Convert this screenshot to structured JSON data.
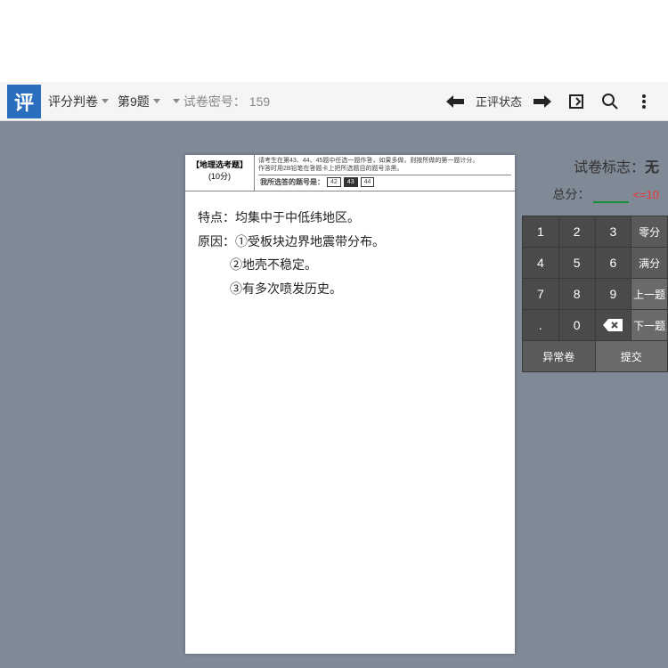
{
  "topbar": {
    "logo_text": "评",
    "grading_label": "评分判卷",
    "question_label": "第9题",
    "secret_prefix": "试卷密号：",
    "secret_value": "159",
    "status_label": "正评状态"
  },
  "paper": {
    "header_title": "【地理选考题】",
    "header_points": "(10分)",
    "instructions_l1": "请考生在第43、44、45题中任选一题作答，如果多做，则按所做的第一题计分。",
    "instructions_l2": "作答时用2B铅笔在答题卡上把所选题目的题号涂黑。",
    "answer_prompt": "我所选答的题号是：",
    "opt1": "42",
    "opt2": "43",
    "opt3": "44",
    "hand_l1": "特点：均集中于中低纬地区。",
    "hand_l2": "原因：①受板块边界地震带分布。",
    "hand_l3": "②地壳不稳定。",
    "hand_l4": "③有多次喷发历史。"
  },
  "side": {
    "mark_label": "试卷标志：",
    "mark_value": "无",
    "total_label": "总分：",
    "max_hint": "<=10",
    "score_value": ""
  },
  "keypad": {
    "k1": "1",
    "k2": "2",
    "k3": "3",
    "zero_score": "零分",
    "k4": "4",
    "k5": "5",
    "k6": "6",
    "full_score": "满分",
    "k7": "7",
    "k8": "8",
    "k9": "9",
    "prev": "上一题",
    "dot": ".",
    "k0": "0",
    "back": "✕",
    "next": "下一题",
    "abnormal": "异常卷",
    "submit": "提交"
  }
}
